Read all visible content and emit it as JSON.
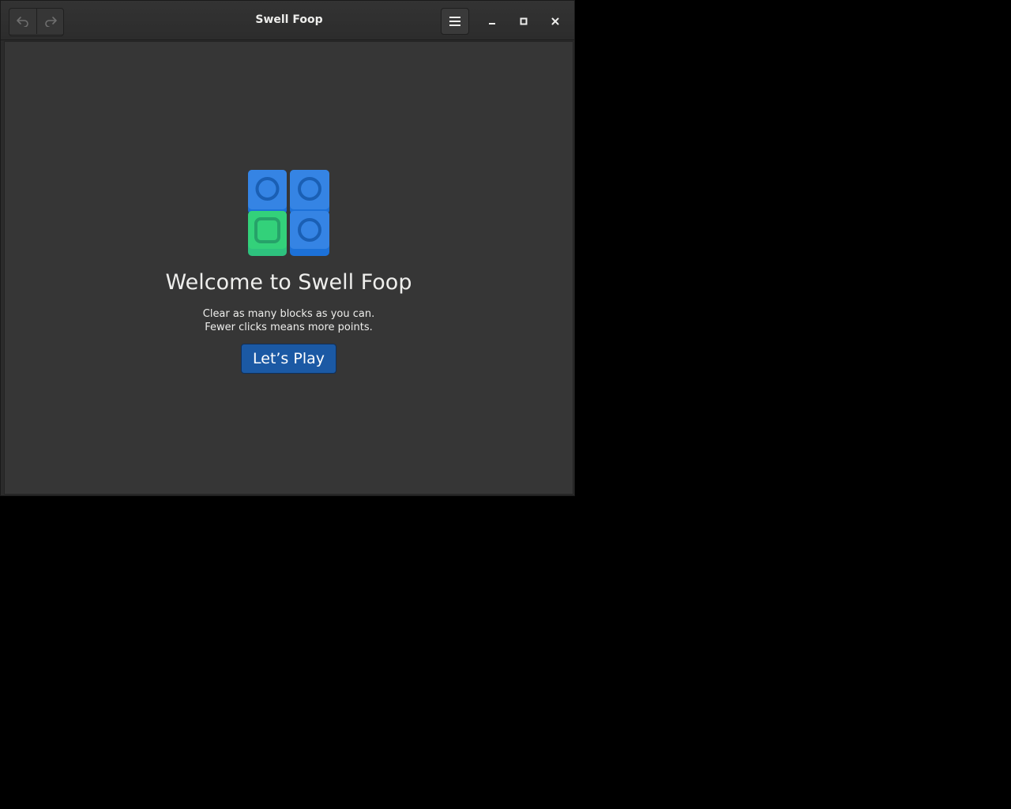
{
  "window": {
    "title": "Swell Foop"
  },
  "headerbar": {
    "icons": {
      "undo": "undo-icon",
      "redo": "redo-icon",
      "menu": "hamburger-menu-icon",
      "minimize": "minimize-icon",
      "maximize": "maximize-icon",
      "close": "close-icon"
    }
  },
  "welcome": {
    "title": "Welcome to Swell Foop",
    "line1": "Clear as many blocks as you can.",
    "line2": "Fewer clicks means more points.",
    "play_label": "Let’s Play"
  },
  "colors": {
    "accent": "#1b59a4",
    "block_blue": "#3584e4",
    "block_green": "#33d17a"
  }
}
